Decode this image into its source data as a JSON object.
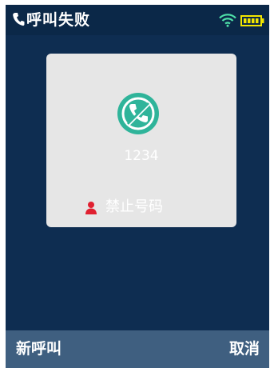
{
  "status_bar": {
    "title": "呼叫失败",
    "phone_icon": "phone-icon",
    "wifi_icon": "wifi-icon",
    "battery_icon": "battery-icon"
  },
  "dialog": {
    "icon": "call-failed-icon",
    "number": "1234",
    "reason_icon": "person-icon",
    "reason": "禁止号码"
  },
  "softkeys": {
    "left": "新呼叫",
    "right": "取消"
  },
  "colors": {
    "screen_background": "#0e2d51",
    "softkey_bar": "#3f5f80",
    "dialog_background": "#e6e6e6",
    "call_icon_green": "#2fb49a",
    "person_icon_red": "#e02030",
    "battery_yellow": "#f2e600",
    "wifi_green": "#4ee0a8"
  }
}
